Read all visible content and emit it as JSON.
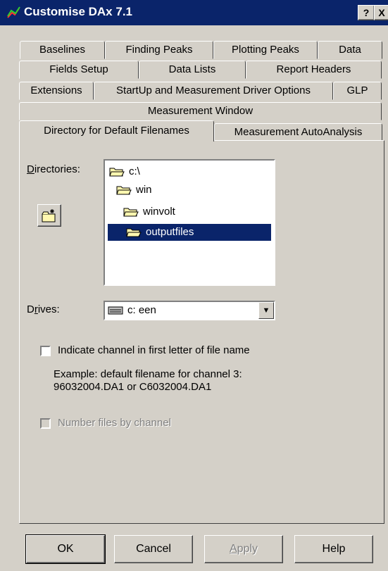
{
  "window": {
    "title": "Customise DAx 7.1",
    "help_glyph": "?",
    "close_glyph": "X"
  },
  "tabs": {
    "row1": [
      "Baselines",
      "Finding Peaks",
      "Plotting Peaks",
      "Data"
    ],
    "row2": [
      "Fields Setup",
      "Data Lists",
      "Report Headers"
    ],
    "row3": [
      "Extensions",
      "StartUp and Measurement Driver Options",
      "GLP"
    ],
    "row4": [
      "Measurement Window"
    ],
    "row5": [
      "Directory for Default Filenames",
      "Measurement AutoAnalysis"
    ],
    "active": "Directory for Default Filenames"
  },
  "directories": {
    "label_u": "D",
    "label_rest": "irectories:",
    "items": [
      "c:\\",
      "win",
      "winvolt",
      "outputfiles"
    ],
    "selected": "outputfiles"
  },
  "drives": {
    "label_pre": "D",
    "label_u": "r",
    "label_rest": "ives:",
    "value": "c:  een"
  },
  "options": {
    "indicate_channel": "Indicate channel in first letter of file name",
    "example_line1": "Example: default filename for channel 3:",
    "example_line2": "96032004.DA1 or C6032004.DA1",
    "number_files": "Number files by channel"
  },
  "buttons": {
    "ok": "OK",
    "cancel": "Cancel",
    "apply_u": "A",
    "apply_rest": "pply",
    "help": "Help"
  }
}
